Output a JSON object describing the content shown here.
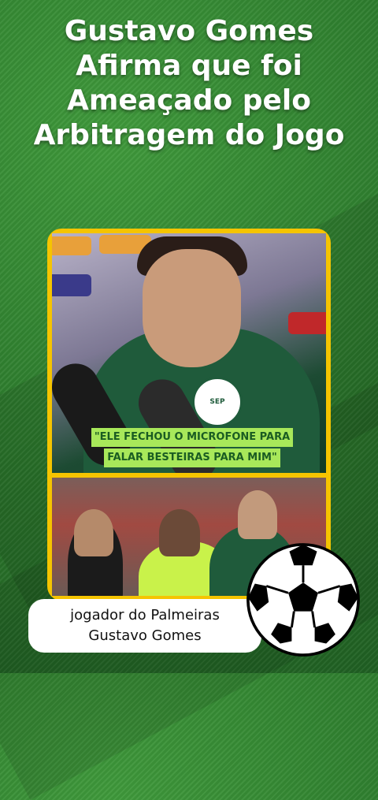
{
  "headline": {
    "line1": "Gustavo Gomes",
    "line2": "Afirma que foi",
    "line3": "Ameaçado pelo",
    "line4": "Arbitragem do Jogo"
  },
  "quote": {
    "line1": "\"ELE FECHOU O MICROFONE PARA",
    "line2": "FALAR BESTEIRAS PARA MIM\""
  },
  "caption": {
    "line1": "jogador do Palmeiras",
    "line2": "Gustavo Gomes"
  },
  "colors": {
    "field": "#2f7f2f",
    "frame": "#f5c400",
    "quote_bg": "#a8e85a",
    "quote_text": "#1a5c22"
  },
  "icons": [
    "soccer-ball-icon"
  ]
}
